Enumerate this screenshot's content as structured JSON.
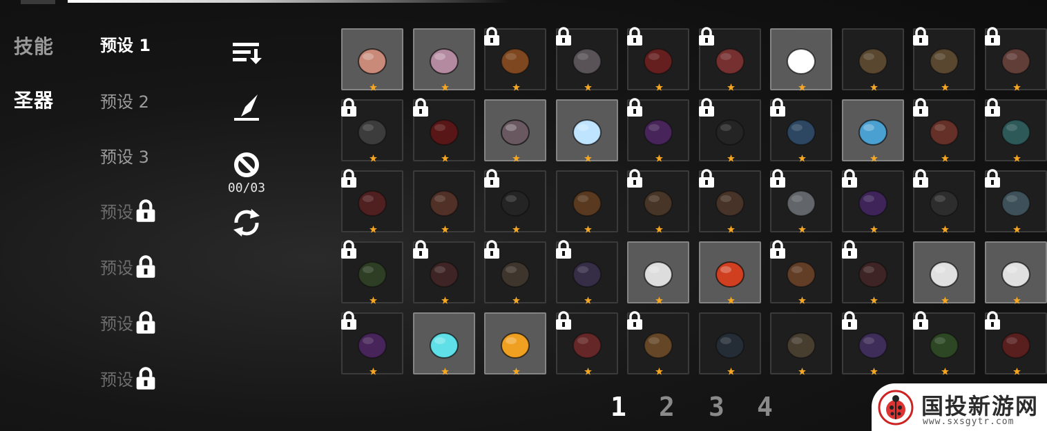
{
  "categories": [
    {
      "label": "技能",
      "active": false
    },
    {
      "label": "圣器",
      "active": true
    }
  ],
  "presets": [
    {
      "label": "预设 1",
      "state": "active"
    },
    {
      "label": "预设 2",
      "state": "normal"
    },
    {
      "label": "预设 3",
      "state": "normal"
    },
    {
      "label": "预设",
      "state": "locked"
    },
    {
      "label": "预设",
      "state": "locked"
    },
    {
      "label": "预设",
      "state": "locked"
    },
    {
      "label": "预设",
      "state": "locked"
    }
  ],
  "toolbar": {
    "sort_icon": "sort-down-icon",
    "edit_icon": "quill-icon",
    "clear_icon": "ban-icon",
    "counter": "00/03",
    "swap_icon": "swap-arrows-icon"
  },
  "items": [
    {
      "name": "rune-stone",
      "owned": true,
      "locked": false,
      "color": "#c98a7a"
    },
    {
      "name": "garlic",
      "owned": true,
      "locked": false,
      "color": "#b48aa0"
    },
    {
      "name": "amber-crystal",
      "owned": false,
      "locked": true,
      "color": "#d06a20"
    },
    {
      "name": "feather",
      "owned": false,
      "locked": true,
      "color": "#8a7f88"
    },
    {
      "name": "red-potion",
      "owned": false,
      "locked": true,
      "color": "#a02020"
    },
    {
      "name": "fox-mask",
      "owned": false,
      "locked": true,
      "color": "#c04040"
    },
    {
      "name": "skull",
      "owned": true,
      "locked": false,
      "color": "#ffffff"
    },
    {
      "name": "scroll-1",
      "owned": false,
      "locked": false,
      "color": "#8a6a40"
    },
    {
      "name": "scroll-2",
      "owned": false,
      "locked": true,
      "color": "#8a6a40"
    },
    {
      "name": "meat",
      "owned": false,
      "locked": true,
      "color": "#9a5a50"
    },
    {
      "name": "beads",
      "owned": false,
      "locked": true,
      "color": "#555555"
    },
    {
      "name": "demon-crest",
      "owned": false,
      "locked": true,
      "color": "#8a1010"
    },
    {
      "name": "stone",
      "owned": true,
      "locked": false,
      "color": "#6a5860"
    },
    {
      "name": "ice-shard",
      "owned": true,
      "locked": false,
      "color": "#bfe4ff"
    },
    {
      "name": "purple-gem",
      "owned": false,
      "locked": true,
      "color": "#6a2a8a"
    },
    {
      "name": "coal",
      "owned": false,
      "locked": true,
      "color": "#2a2a2a"
    },
    {
      "name": "blue-shell",
      "owned": false,
      "locked": true,
      "color": "#3a6a9a"
    },
    {
      "name": "blue-tree",
      "owned": true,
      "locked": false,
      "color": "#4aa0d0"
    },
    {
      "name": "red-mushroom",
      "owned": false,
      "locked": true,
      "color": "#a04030"
    },
    {
      "name": "teal-beans",
      "owned": false,
      "locked": true,
      "color": "#3a8a8a"
    },
    {
      "name": "red-scarf",
      "owned": false,
      "locked": true,
      "color": "#7a2020"
    },
    {
      "name": "clay-vase",
      "owned": false,
      "locked": false,
      "color": "#7a4030"
    },
    {
      "name": "spoon",
      "owned": false,
      "locked": true,
      "color": "#2a2a2a"
    },
    {
      "name": "pipe",
      "owned": false,
      "locked": false,
      "color": "#8a5020"
    },
    {
      "name": "boot",
      "owned": false,
      "locked": true,
      "color": "#6a4a30"
    },
    {
      "name": "plank",
      "owned": false,
      "locked": true,
      "color": "#6a4530"
    },
    {
      "name": "snow-globe",
      "owned": false,
      "locked": true,
      "color": "#9aa0a8"
    },
    {
      "name": "purple-jar",
      "owned": false,
      "locked": true,
      "color": "#5a2a8a"
    },
    {
      "name": "dark-box",
      "owned": false,
      "locked": true,
      "color": "#3a3a3a"
    },
    {
      "name": "glass-cube",
      "owned": false,
      "locked": true,
      "color": "#5a7a8a"
    },
    {
      "name": "green-ring",
      "owned": false,
      "locked": true,
      "color": "#3a5a2a"
    },
    {
      "name": "crossbow",
      "owned": false,
      "locked": true,
      "color": "#5a2a2a"
    },
    {
      "name": "rock-lump",
      "owned": false,
      "locked": true,
      "color": "#5a4a3a"
    },
    {
      "name": "staff",
      "owned": false,
      "locked": true,
      "color": "#4a3a6a"
    },
    {
      "name": "crossed-swords",
      "owned": true,
      "locked": false,
      "color": "#dddddd"
    },
    {
      "name": "red-crystal",
      "owned": true,
      "locked": false,
      "color": "#d04020"
    },
    {
      "name": "book",
      "owned": false,
      "locked": true,
      "color": "#9a5a30"
    },
    {
      "name": "red-feather",
      "owned": false,
      "locked": true,
      "color": "#5a2a2a"
    },
    {
      "name": "dagger",
      "owned": true,
      "locked": false,
      "color": "#e0e0e0"
    },
    {
      "name": "knife",
      "owned": true,
      "locked": false,
      "color": "#e0e0e0"
    },
    {
      "name": "purple-orb",
      "owned": false,
      "locked": true,
      "color": "#6a2a8a"
    },
    {
      "name": "cyan-spirit",
      "owned": true,
      "locked": false,
      "color": "#5fe0e8"
    },
    {
      "name": "gold-bar",
      "owned": true,
      "locked": false,
      "color": "#f0a020"
    },
    {
      "name": "red-boot",
      "owned": false,
      "locked": true,
      "color": "#a03030"
    },
    {
      "name": "cookie",
      "owned": false,
      "locked": true,
      "color": "#a06a30"
    },
    {
      "name": "spider",
      "owned": false,
      "locked": false,
      "color": "#2a3a4a"
    },
    {
      "name": "pale-rock",
      "owned": false,
      "locked": false,
      "color": "#6a5a40"
    },
    {
      "name": "purple-frog",
      "owned": false,
      "locked": true,
      "color": "#5a3a8a"
    },
    {
      "name": "green-slime",
      "owned": false,
      "locked": true,
      "color": "#3a6a2a"
    },
    {
      "name": "red-berries",
      "owned": false,
      "locked": true,
      "color": "#8a2020"
    }
  ],
  "pagination": [
    {
      "label": "1",
      "active": true
    },
    {
      "label": "2",
      "active": false
    },
    {
      "label": "3",
      "active": false
    },
    {
      "label": "4",
      "active": false
    }
  ],
  "watermark": {
    "name": "国投新游网",
    "url": "www.sxsgytr.com"
  }
}
